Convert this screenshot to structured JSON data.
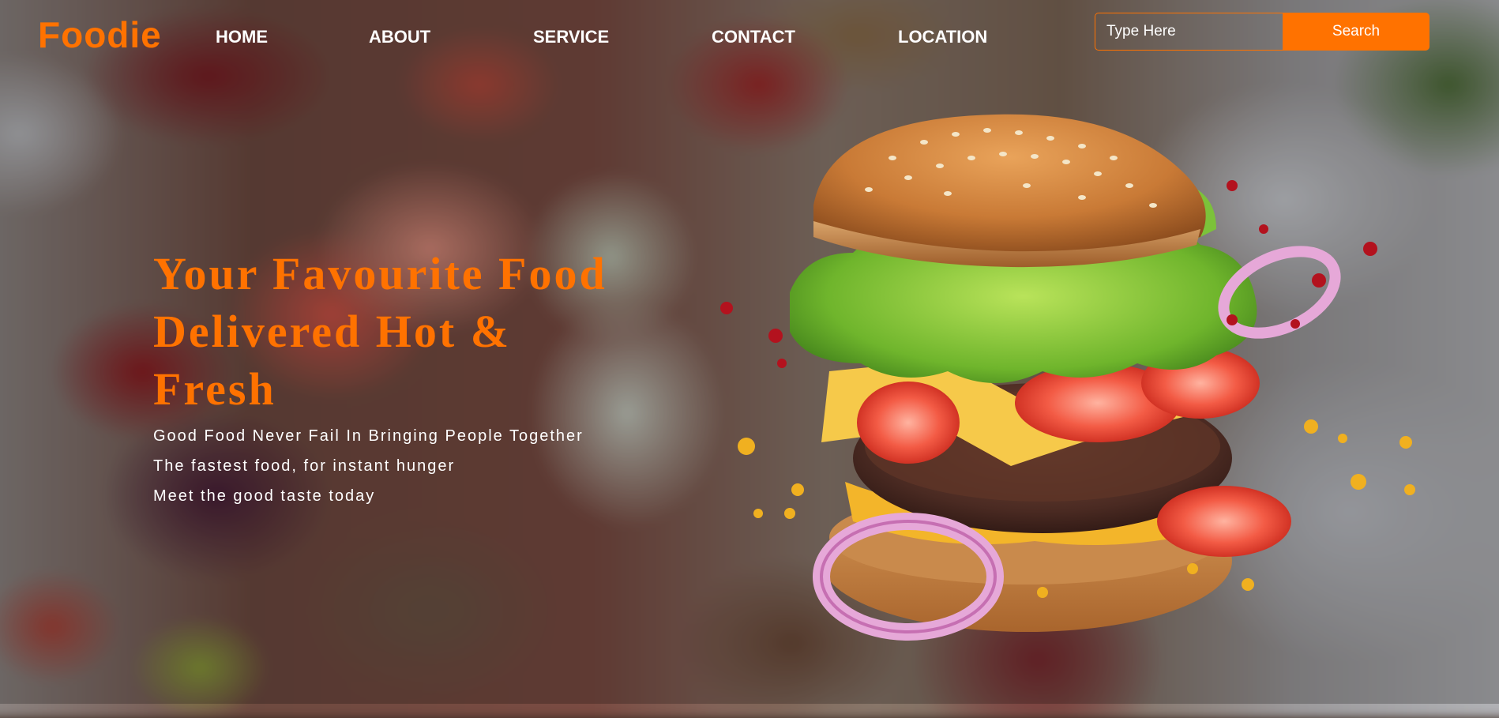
{
  "brand": {
    "name": "Foodie",
    "accent_color": "#ff7200"
  },
  "nav": {
    "items": [
      {
        "label": "HOME"
      },
      {
        "label": "ABOUT"
      },
      {
        "label": "SERVICE"
      },
      {
        "label": "CONTACT"
      },
      {
        "label": "LOCATION"
      }
    ]
  },
  "search": {
    "placeholder": "Type Here",
    "button_label": "Search"
  },
  "hero": {
    "title_lines": [
      "Your Favourite Food",
      "Delivered Hot &",
      "Fresh"
    ],
    "taglines": [
      "Good Food Never Fail In Bringing People Together",
      "The fastest food, for instant hunger",
      "Meet the good taste today"
    ],
    "image": "burger-illustration"
  },
  "background": {
    "image": "blurred-food-table"
  }
}
